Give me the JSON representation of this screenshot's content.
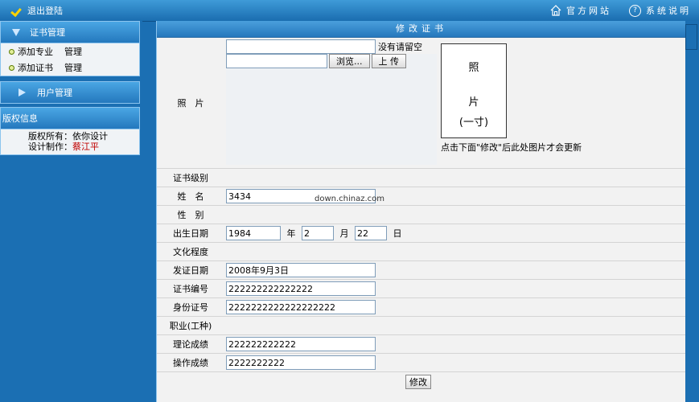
{
  "topbar": {
    "logout": "退出登陆",
    "official_site": "官方网站",
    "help": "系统说明"
  },
  "sidebar": {
    "cert_section": "证书管理",
    "items": [
      {
        "label": "添加专业",
        "action": "管理"
      },
      {
        "label": "添加证书",
        "action": "管理"
      }
    ],
    "user_section": "用户管理",
    "copyright_section": "版权信息",
    "copyright_owner_label": "版权所有：",
    "copyright_owner": "依你设计",
    "design_label": "设计制作：",
    "designer": "蔡江平"
  },
  "main": {
    "title": "修改证书",
    "photo_label": "照　片",
    "upload_hint": "没有请留空",
    "browse_button": "浏览...",
    "upload_button": "上 传",
    "photo_placeholder_1": "照",
    "photo_placeholder_2": "片",
    "photo_placeholder_3": "(一寸)",
    "photo_note": "点击下面\"修改\"后此处图片才会更新",
    "watermark": "down.chinaz.com",
    "fields": {
      "level": {
        "label": "证书级别",
        "value": ""
      },
      "name": {
        "label": "姓　名",
        "value": "3434"
      },
      "gender": {
        "label": "性　别",
        "value": ""
      },
      "birth": {
        "label": "出生日期",
        "year": "1984",
        "year_unit": "年",
        "month": "2",
        "month_unit": "月",
        "day": "22",
        "day_unit": "日"
      },
      "education": {
        "label": "文化程度",
        "value": ""
      },
      "issue_date": {
        "label": "发证日期",
        "value": "2008年9月3日"
      },
      "cert_no": {
        "label": "证书编号",
        "value": "222222222222222"
      },
      "id_no": {
        "label": "身份证号",
        "value": "2222222222222222222"
      },
      "occupation": {
        "label": "职业(工种)",
        "value": ""
      },
      "theory_score": {
        "label": "理论成绩",
        "value": "222222222222"
      },
      "practice_score": {
        "label": "操作成绩",
        "value": "2222222222"
      }
    },
    "submit_button": "修改"
  }
}
